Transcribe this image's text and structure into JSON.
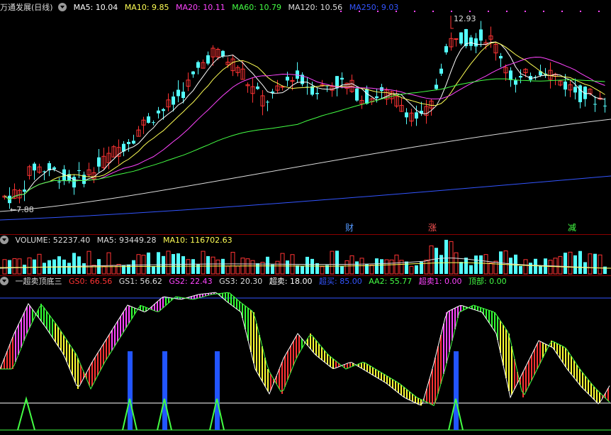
{
  "main": {
    "title": "万通发展(日线)",
    "ma": [
      {
        "label": "MA5: 10.04",
        "color": "#ffffff"
      },
      {
        "label": "MA10: 9.85",
        "color": "#ffff55"
      },
      {
        "label": "MA20: 10.11",
        "color": "#ff44ff"
      },
      {
        "label": "MA60: 10.79",
        "color": "#44ff44"
      },
      {
        "label": "MA120: 10.56",
        "color": "#dddddd"
      },
      {
        "label": "MA250: 9.03",
        "color": "#3355ff"
      }
    ],
    "high_label": "12.93",
    "low_label": "7.88",
    "markers": [
      {
        "text": "财",
        "color": "#5599ff"
      },
      {
        "text": "涨",
        "color": "#ff5555"
      },
      {
        "text": "减",
        "color": "#44ff44"
      }
    ]
  },
  "volume": {
    "labels": [
      {
        "label": "VOLUME: 52237.40",
        "color": "#dddddd"
      },
      {
        "label": "MA5: 93449.28",
        "color": "#dddddd"
      },
      {
        "label": "MA10: 116702.63",
        "color": "#ffff55"
      }
    ]
  },
  "indicator": {
    "title": "一超卖顶底三",
    "labels": [
      {
        "label": "GS0: 66.56",
        "color": "#ff3333"
      },
      {
        "label": "GS1: 56.62",
        "color": "#dddddd"
      },
      {
        "label": "GS2: 22.43",
        "color": "#ff44ff"
      },
      {
        "label": "GS3: 20.30",
        "color": "#dddddd"
      },
      {
        "label": "超卖: 18.00",
        "color": "#ffffff"
      },
      {
        "label": "超买: 85.00",
        "color": "#3355ff"
      },
      {
        "label": "AA2: 55.77",
        "color": "#44ff44"
      },
      {
        "label": "超卖1: 0.00",
        "color": "#ff44ff"
      },
      {
        "label": "顶部: 0.00",
        "color": "#44ff44"
      }
    ]
  },
  "colors": {
    "up": "#ff3333",
    "down": "#54ffff",
    "bg": "#000000"
  }
}
